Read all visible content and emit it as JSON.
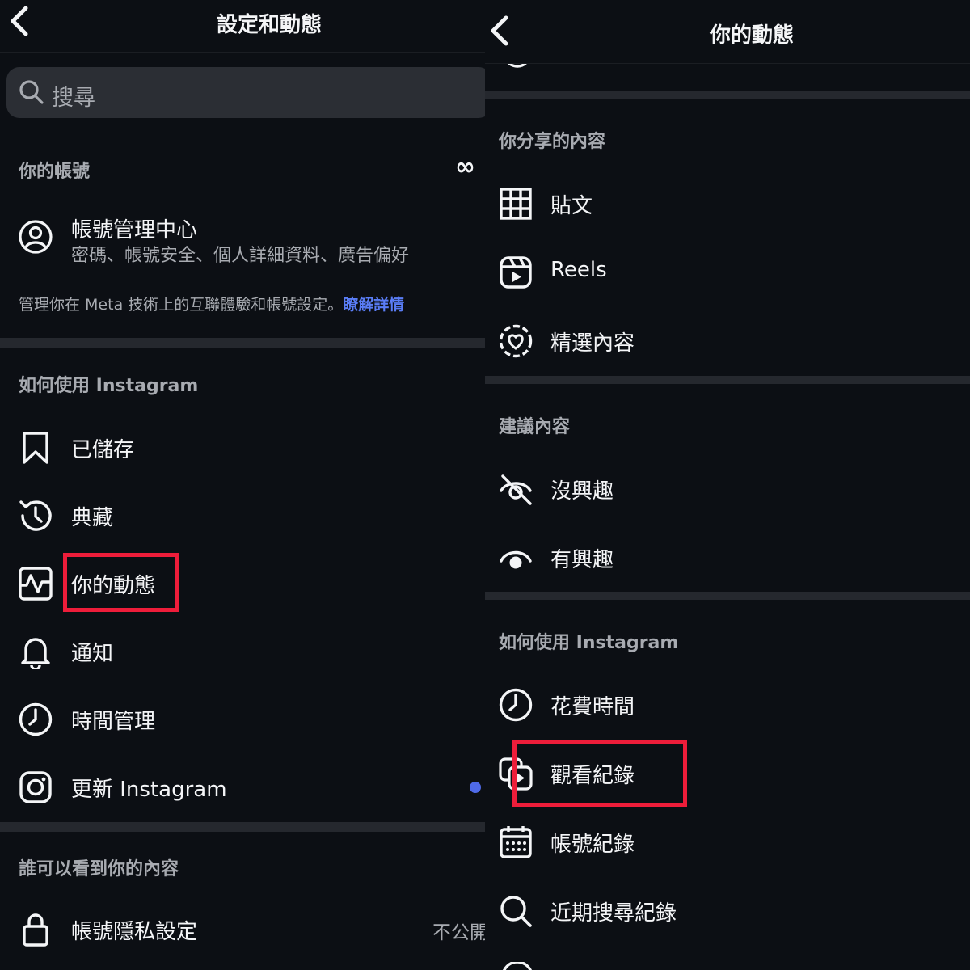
{
  "left": {
    "title": "設定和動態",
    "search_placeholder": "搜尋",
    "account_section": "你的帳號",
    "meta_logo": "∞",
    "accounts_center": {
      "title": "帳號管理中心",
      "subtitle": "密碼、帳號安全、個人詳細資料、廣告偏好"
    },
    "meta_note": "管理你在 Meta 技術上的互聯體驗和帳號設定。",
    "meta_link": "瞭解詳情",
    "how_section": "如何使用 Instagram",
    "items": [
      {
        "label": "已儲存",
        "icon": "bookmark-icon"
      },
      {
        "label": "典藏",
        "icon": "archive-history-icon"
      },
      {
        "label": "你的動態",
        "icon": "activity-icon"
      },
      {
        "label": "通知",
        "icon": "bell-icon"
      },
      {
        "label": "時間管理",
        "icon": "clock-icon"
      },
      {
        "label": "更新 Instagram",
        "icon": "instagram-icon"
      }
    ],
    "who_section": "誰可以看到你的內容",
    "privacy": {
      "label": "帳號隱私設定",
      "value": "不公開",
      "icon": "lock-icon"
    }
  },
  "right": {
    "title": "你的動態",
    "shared_section": "你分享的內容",
    "shared_items": [
      {
        "label": "貼文",
        "icon": "grid-icon"
      },
      {
        "label": "Reels",
        "icon": "reels-icon"
      },
      {
        "label": "精選內容",
        "icon": "highlights-icon"
      }
    ],
    "suggested_section": "建議內容",
    "suggested_items": [
      {
        "label": "沒興趣",
        "icon": "eye-off-icon"
      },
      {
        "label": "有興趣",
        "icon": "eye-icon"
      }
    ],
    "how_section": "如何使用 Instagram",
    "how_items": [
      {
        "label": "花費時間",
        "icon": "clock-icon"
      },
      {
        "label": "觀看紀錄",
        "icon": "watch-history-icon"
      },
      {
        "label": "帳號紀錄",
        "icon": "calendar-icon"
      },
      {
        "label": "近期搜尋紀錄",
        "icon": "search-icon"
      }
    ]
  },
  "colors": {
    "background": "#0c0f14",
    "highlight_box": "#ee1d3a",
    "link": "#5a7df6",
    "notification_dot": "#4f6ae8"
  }
}
